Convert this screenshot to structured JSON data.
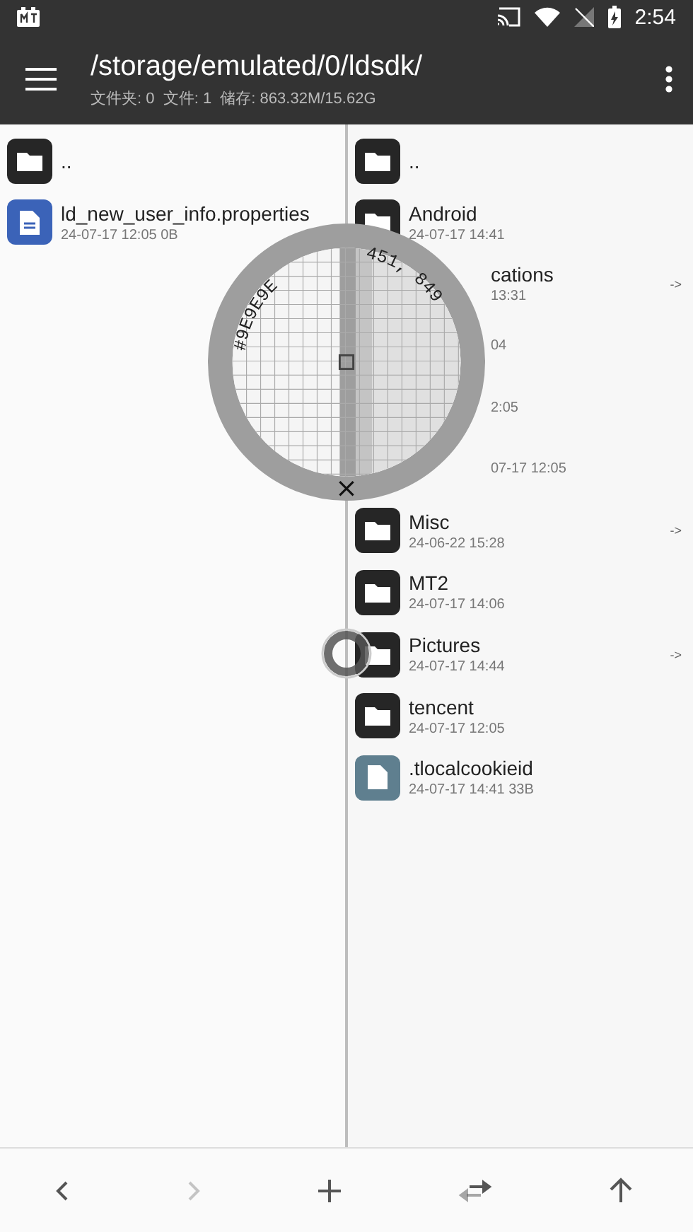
{
  "status_bar": {
    "time": "2:54"
  },
  "toolbar": {
    "path": "/storage/emulated/0/ldsdk/",
    "summary": "文件夹: 0  文件: 1  储存: 863.32M/15.62G"
  },
  "left_pane": {
    "items": [
      {
        "kind": "folder",
        "name": ".."
      },
      {
        "kind": "document",
        "name": "ld_new_user_info.properties",
        "meta": "24-07-17 12:05  0B"
      }
    ]
  },
  "right_pane": {
    "items": [
      {
        "kind": "folder",
        "name": ".."
      },
      {
        "kind": "folder",
        "name": "Android",
        "meta": "24-07-17 14:41"
      },
      {
        "kind": "covered",
        "name": "cations",
        "meta": "13:31",
        "link": "->"
      },
      {
        "kind": "covered",
        "meta": "04"
      },
      {
        "kind": "covered",
        "meta": "2:05"
      },
      {
        "kind": "covered",
        "meta": "07-17 12:05"
      },
      {
        "kind": "folder",
        "name": "Misc",
        "meta": "24-06-22 15:28",
        "link": "->"
      },
      {
        "kind": "folder",
        "name": "MT2",
        "meta": "24-07-17 14:06"
      },
      {
        "kind": "folder",
        "name": "Pictures",
        "meta": "24-07-17 14:44",
        "link": "->"
      },
      {
        "kind": "folder",
        "name": "tencent",
        "meta": "24-07-17 12:05"
      },
      {
        "kind": "file",
        "name": ".tlocalcookieid",
        "meta": "24-07-17 14:41  33B"
      }
    ]
  },
  "magnifier": {
    "color_code": "#9E9E9E",
    "coordinates": "451, 849"
  },
  "bottom_bar": [
    {
      "kind": "back",
      "disabled": false
    },
    {
      "kind": "forward",
      "disabled": true
    },
    {
      "kind": "add",
      "disabled": false
    },
    {
      "kind": "swap",
      "disabled": false
    },
    {
      "kind": "up",
      "disabled": false
    }
  ]
}
